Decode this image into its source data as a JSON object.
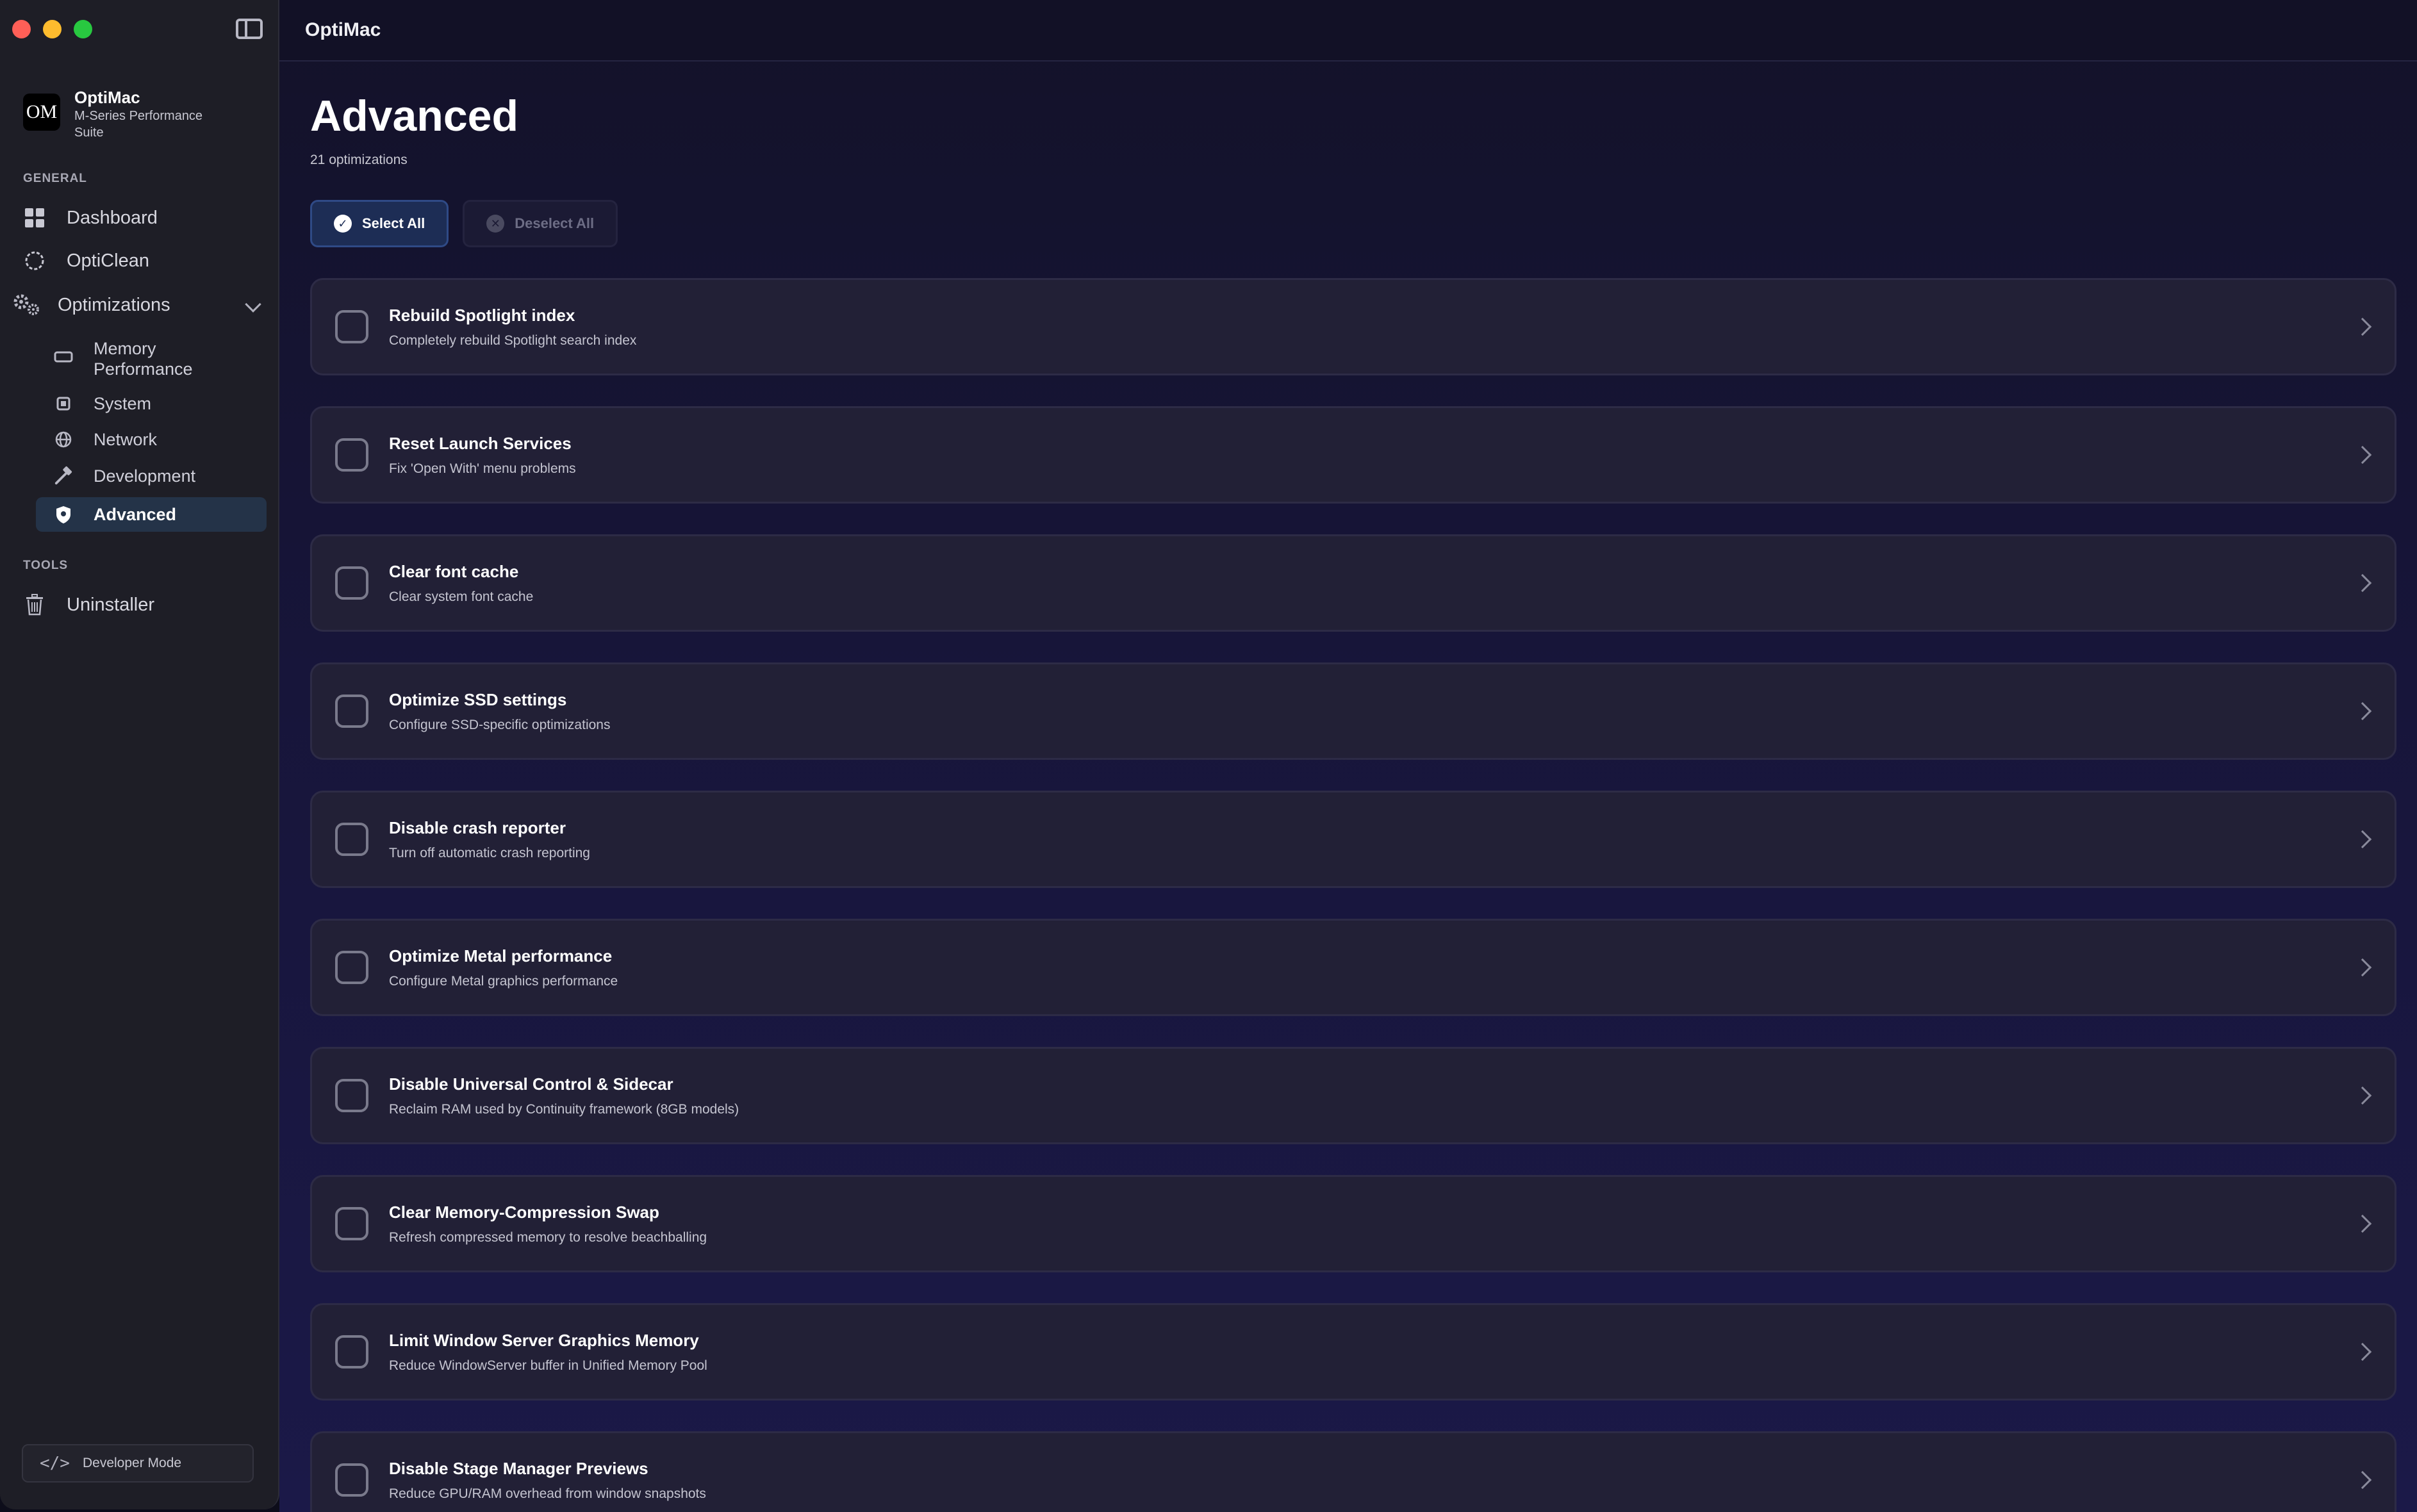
{
  "window": {
    "title": "OptiMac"
  },
  "brand": {
    "logo_text": "OM",
    "name": "OptiMac",
    "subtitle": "M-Series Performance Suite"
  },
  "sidebar": {
    "general_label": "GENERAL",
    "general_items": [
      {
        "label": "Dashboard",
        "icon": "grid-icon"
      },
      {
        "label": "OptiClean",
        "icon": "circle-icon"
      },
      {
        "label": "Optimizations",
        "icon": "gears-icon"
      }
    ],
    "sub_items": [
      {
        "label": "Memory Performance",
        "icon": "memory-icon"
      },
      {
        "label": "System",
        "icon": "cpu-icon"
      },
      {
        "label": "Network",
        "icon": "globe-icon"
      },
      {
        "label": "Development",
        "icon": "hammer-icon"
      },
      {
        "label": "Advanced",
        "icon": "shield-icon",
        "active": true
      }
    ],
    "tools_label": "TOOLS",
    "tools_items": [
      {
        "label": "Uninstaller",
        "icon": "trash-icon"
      }
    ],
    "developer_mode_label": "Developer Mode"
  },
  "main": {
    "title": "Advanced",
    "count": "21 optimizations",
    "select_all": "Select All",
    "deselect_all": "Deselect All",
    "items": [
      {
        "title": "Rebuild Spotlight index",
        "desc": "Completely rebuild Spotlight search index"
      },
      {
        "title": "Reset Launch Services",
        "desc": "Fix 'Open With' menu problems"
      },
      {
        "title": "Clear font cache",
        "desc": "Clear system font cache"
      },
      {
        "title": "Optimize SSD settings",
        "desc": "Configure SSD-specific optimizations"
      },
      {
        "title": "Disable crash reporter",
        "desc": "Turn off automatic crash reporting"
      },
      {
        "title": "Optimize Metal performance",
        "desc": "Configure Metal graphics performance"
      },
      {
        "title": "Disable Universal Control & Sidecar",
        "desc": "Reclaim RAM used by Continuity framework (8GB models)"
      },
      {
        "title": "Clear Memory-Compression Swap",
        "desc": "Refresh compressed memory to resolve beachballing"
      },
      {
        "title": "Limit Window Server Graphics Memory",
        "desc": "Reduce WindowServer buffer in Unified Memory Pool"
      },
      {
        "title": "Disable Stage Manager Previews",
        "desc": "Reduce GPU/RAM overhead from window snapshots"
      }
    ]
  },
  "colors": {
    "accent": "#2f4a86",
    "active_nav": "#243348",
    "sidebar_bg": "#1e1e26"
  }
}
